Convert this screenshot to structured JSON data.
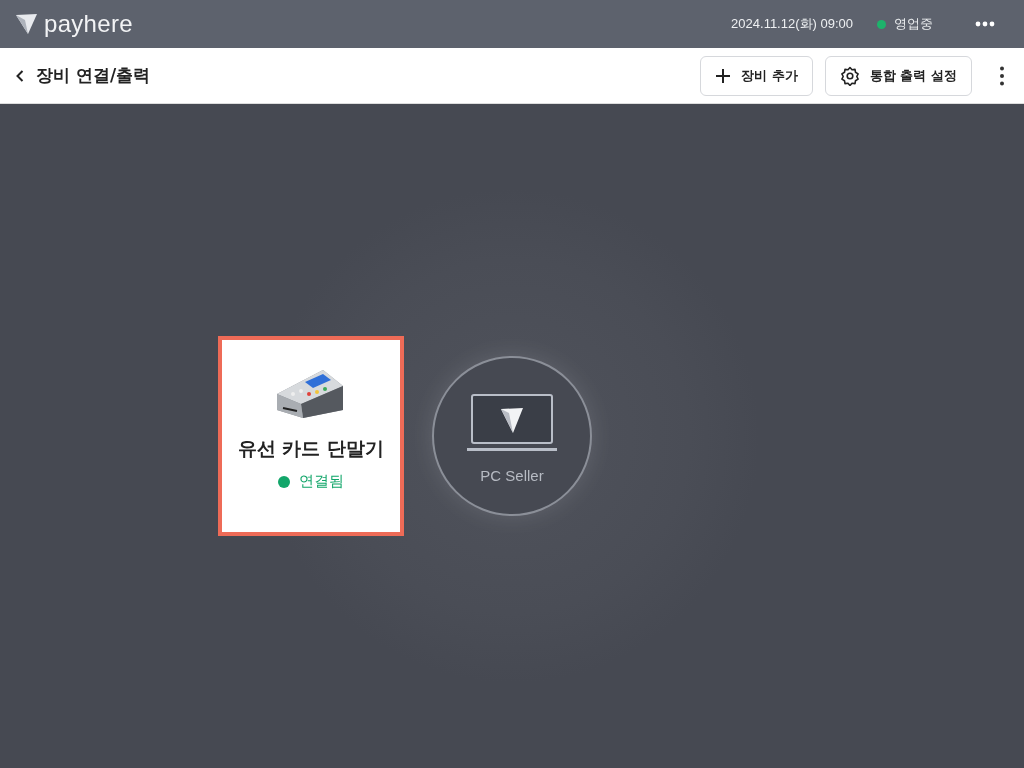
{
  "top_bar": {
    "logo": "payhere",
    "datetime": "2024.11.12(화) 09:00",
    "store_status": {
      "label": "영업중",
      "color": "#1db36b"
    }
  },
  "header": {
    "title": "장비 연결/출력",
    "buttons": [
      {
        "kind": "add",
        "label": "장비 추가"
      },
      {
        "kind": "settings",
        "label": "통합 출력 설정"
      }
    ]
  },
  "canvas": {
    "devices": [
      {
        "name": "유선 카드 단말기",
        "status": "연결됨",
        "color": "#12a66a",
        "selected": true
      }
    ],
    "hub": {
      "label": "PC Seller"
    }
  }
}
